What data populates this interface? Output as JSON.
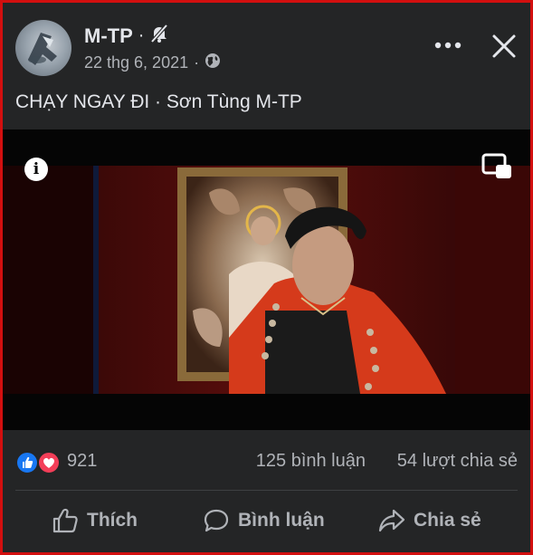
{
  "post": {
    "author": "M-TP",
    "separator": "·",
    "date": "22 thg 6, 2021",
    "date_separator": "·",
    "caption": "CHẠY NGAY ĐI · Sơn Tùng M-TP"
  },
  "icons": {
    "muted_bell": "bell-slash-icon",
    "privacy": "globe-icon",
    "more": "more-options-icon",
    "close": "close-icon",
    "info": "info-icon",
    "pip": "picture-in-picture-icon"
  },
  "video": {
    "info_glyph": "i"
  },
  "stats": {
    "reaction_count": "921",
    "comments": "125 bình luận",
    "shares": "54 lượt chia sẻ"
  },
  "actions": {
    "like": "Thích",
    "comment": "Bình luận",
    "share": "Chia sẻ"
  },
  "colors": {
    "background": "#242526",
    "text_primary": "#e4e6eb",
    "text_secondary": "#b0b3b8",
    "like_blue": "#1877f2",
    "love_red": "#f33e58",
    "frame_red": "#d20f0f"
  }
}
